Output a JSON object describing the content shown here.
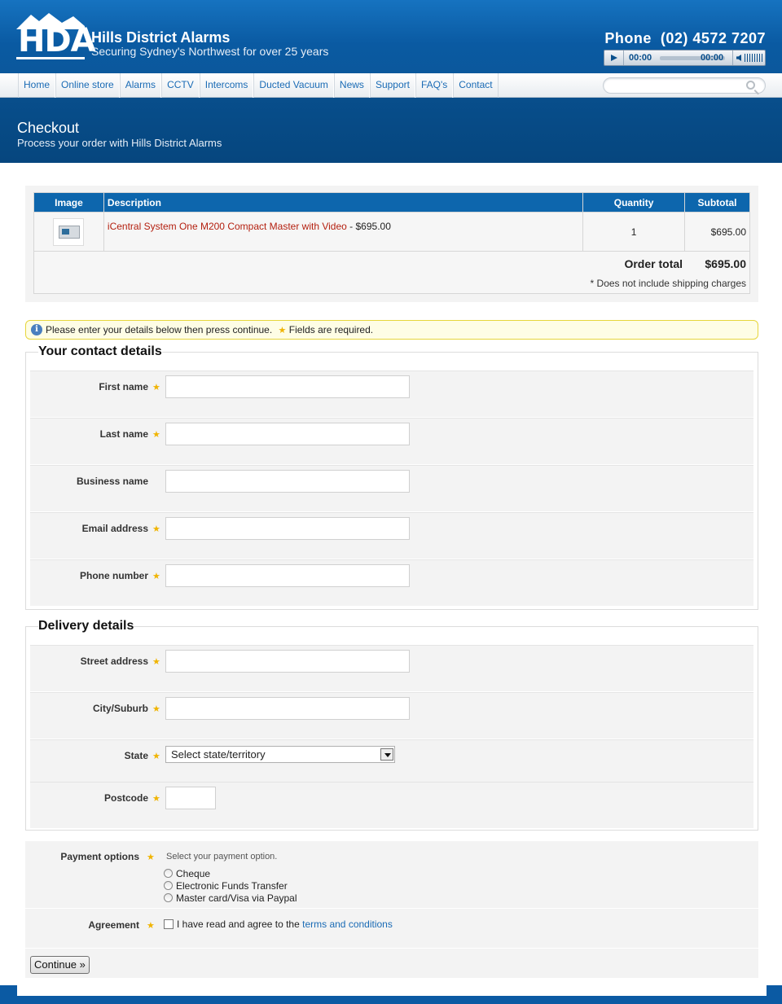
{
  "header": {
    "logo_text": "HDA",
    "site_name": "Hills District Alarms",
    "tagline": "Securing Sydney's Northwest for over 25 years",
    "phone": "Phone  (02) 4572 7207",
    "player": {
      "current_time": "00:00",
      "duration": "00:00"
    }
  },
  "nav": {
    "items": [
      {
        "label": "Home"
      },
      {
        "label": "Online store"
      },
      {
        "label": "Alarms"
      },
      {
        "label": "CCTV"
      },
      {
        "label": "Intercoms"
      },
      {
        "label": "Ducted Vacuum"
      },
      {
        "label": "News"
      },
      {
        "label": "Support"
      },
      {
        "label": "FAQ's"
      },
      {
        "label": "Contact"
      }
    ],
    "search_placeholder": ""
  },
  "page": {
    "title": "Checkout",
    "subtitle": "Process your order with Hills District Alarms"
  },
  "cart": {
    "headers": {
      "image": "Image",
      "description": "Description",
      "quantity": "Quantity",
      "subtotal": "Subtotal"
    },
    "items": [
      {
        "name": "iCentral System One M200 Compact Master with Video",
        "price_suffix": " - $695.00",
        "quantity": "1",
        "subtotal": "$695.00"
      }
    ],
    "order_total_label": "Order total",
    "order_total": "$695.00",
    "shipping_note": "* Does not include shipping charges"
  },
  "notice": {
    "text": "Please enter your details below then press continue.",
    "required_text": "Fields are required."
  },
  "contact": {
    "legend": "Your contact details",
    "fields": [
      {
        "label": "First name",
        "required": true,
        "value": ""
      },
      {
        "label": "Last name",
        "required": true,
        "value": ""
      },
      {
        "label": "Business name",
        "required": false,
        "value": ""
      },
      {
        "label": "Email address",
        "required": true,
        "value": ""
      },
      {
        "label": "Phone number",
        "required": true,
        "value": ""
      }
    ]
  },
  "delivery": {
    "legend": "Delivery details",
    "street_label": "Street address",
    "city_label": "City/Suburb",
    "state_label": "State",
    "state_selected": "Select state/territory",
    "postcode_label": "Postcode"
  },
  "payment": {
    "label": "Payment options",
    "hint": "Select your payment option.",
    "options": [
      {
        "label": "Cheque"
      },
      {
        "label": "Electronic Funds Transfer"
      },
      {
        "label": "Master card/Visa via Paypal"
      }
    ]
  },
  "agreement": {
    "label": "Agreement",
    "text": "I have read and agree to the ",
    "link": "terms and conditions"
  },
  "continue_label": "Continue »",
  "colors": {
    "brand_blue": "#0a5aa2",
    "link": "#1a6bb5",
    "product_link": "#b42010",
    "required_star": "#f0b400"
  }
}
